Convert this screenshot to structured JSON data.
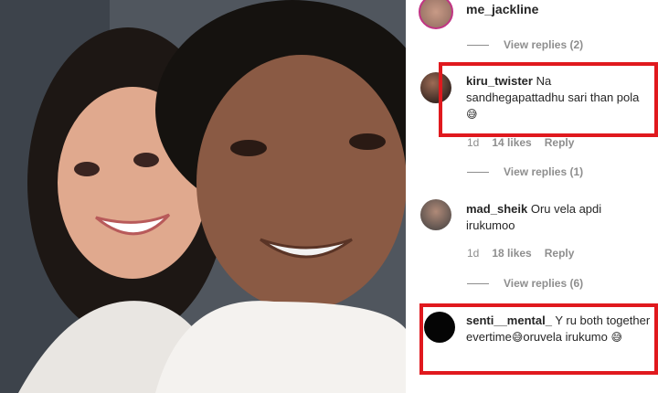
{
  "photo": {
    "alt_icon": "selfie-photo"
  },
  "comments": {
    "top_user": "me_jackline",
    "top_replies": "View replies (2)",
    "c1": {
      "user": "kiru_twister",
      "text": "Na sandhegapattadhu sari than pola",
      "emoji": "😅",
      "age": "1d",
      "likes": "14 likes",
      "reply": "Reply",
      "replies": "View replies (1)"
    },
    "c2": {
      "user": "mad_sheik",
      "text": "Oru vela apdi irukumoo",
      "age": "1d",
      "likes": "18 likes",
      "reply": "Reply",
      "replies": "View replies (6)"
    },
    "c3": {
      "user": "senti__mental_",
      "text_a": "Y ru both together evertime",
      "emoji_a": "😅",
      "text_b": "oruvela irukumo",
      "emoji_b": "😅"
    }
  },
  "colors": {
    "highlight": "#e0191e",
    "muted": "#8e8e8e",
    "text": "#262626"
  }
}
